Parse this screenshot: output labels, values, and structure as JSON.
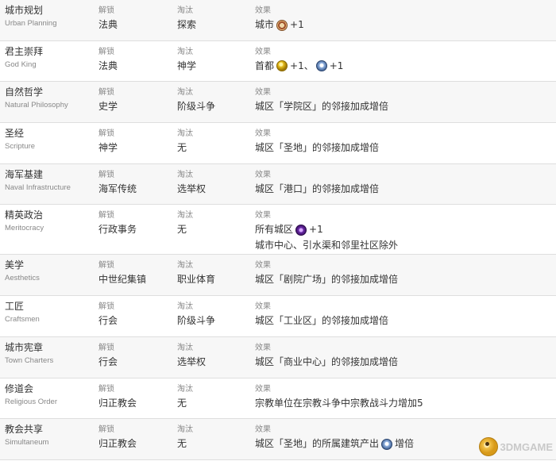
{
  "rows": [
    {
      "name_cn": "城市规划",
      "name_en": "Urban Planning",
      "unlock_label": "解锁",
      "unlock": "法典",
      "obsolete_label": "淘汰",
      "obsolete": "探索",
      "effect_label": "效果",
      "effect": {
        "prefix": "城市",
        "icon": "culture-icon",
        "suffix": "+1"
      }
    },
    {
      "name_cn": "君主崇拜",
      "name_en": "God King",
      "unlock_label": "解锁",
      "unlock": "法典",
      "obsolete_label": "淘汰",
      "obsolete": "神学",
      "effect_label": "效果",
      "effect": {
        "prefix": "首都",
        "icon1": "gold-icon",
        "mid": "+1、",
        "icon2": "faith-icon",
        "suffix": "+1"
      }
    },
    {
      "name_cn": "自然哲学",
      "name_en": "Natural Philosophy",
      "unlock_label": "解锁",
      "unlock": "史学",
      "obsolete_label": "淘汰",
      "obsolete": "阶级斗争",
      "effect_label": "效果",
      "effect": {
        "text": "城区「学院区」的邻接加成增倍"
      }
    },
    {
      "name_cn": "圣经",
      "name_en": "Scripture",
      "unlock_label": "解锁",
      "unlock": "神学",
      "obsolete_label": "淘汰",
      "obsolete": "无",
      "effect_label": "效果",
      "effect": {
        "text": "城区「圣地」的邻接加成增倍"
      }
    },
    {
      "name_cn": "海军基建",
      "name_en": "Naval Infrastructure",
      "unlock_label": "解锁",
      "unlock": "海军传统",
      "obsolete_label": "淘汰",
      "obsolete": "选举权",
      "effect_label": "效果",
      "effect": {
        "text": "城区「港口」的邻接加成增倍"
      }
    },
    {
      "name_cn": "精英政治",
      "name_en": "Meritocracy",
      "unlock_label": "解锁",
      "unlock": "行政事务",
      "obsolete_label": "淘汰",
      "obsolete": "无",
      "effect_label": "效果",
      "effect": {
        "prefix": "所有城区",
        "icon": "amenity-icon",
        "suffix": "+1",
        "line2": "城市中心、引水渠和邻里社区除外"
      }
    },
    {
      "name_cn": "美学",
      "name_en": "Aesthetics",
      "unlock_label": "解锁",
      "unlock": "中世纪集镇",
      "obsolete_label": "淘汰",
      "obsolete": "职业体育",
      "effect_label": "效果",
      "effect": {
        "text": "城区「剧院广场」的邻接加成增倍"
      }
    },
    {
      "name_cn": "工匠",
      "name_en": "Craftsmen",
      "unlock_label": "解锁",
      "unlock": "行会",
      "obsolete_label": "淘汰",
      "obsolete": "阶级斗争",
      "effect_label": "效果",
      "effect": {
        "text": "城区「工业区」的邻接加成增倍"
      }
    },
    {
      "name_cn": "城市宪章",
      "name_en": "Town Charters",
      "unlock_label": "解锁",
      "unlock": "行会",
      "obsolete_label": "淘汰",
      "obsolete": "选举权",
      "effect_label": "效果",
      "effect": {
        "text": "城区「商业中心」的邻接加成增倍"
      }
    },
    {
      "name_cn": "修道会",
      "name_en": "Religious Order",
      "unlock_label": "解锁",
      "unlock": "归正教会",
      "obsolete_label": "淘汰",
      "obsolete": "无",
      "effect_label": "效果",
      "effect": {
        "text": "宗教单位在宗教斗争中宗教战斗力增加5"
      }
    },
    {
      "name_cn": "教会共享",
      "name_en": "Simultaneum",
      "unlock_label": "解锁",
      "unlock": "归正教会",
      "obsolete_label": "淘汰",
      "obsolete": "无",
      "effect_label": "效果",
      "effect": {
        "prefix": "城区「圣地」的所属建筑产出",
        "icon": "faith-icon",
        "suffix": "增倍"
      }
    }
  ],
  "watermark": {
    "text": "3DMGAME",
    "icon": "3dm-logo-icon"
  }
}
